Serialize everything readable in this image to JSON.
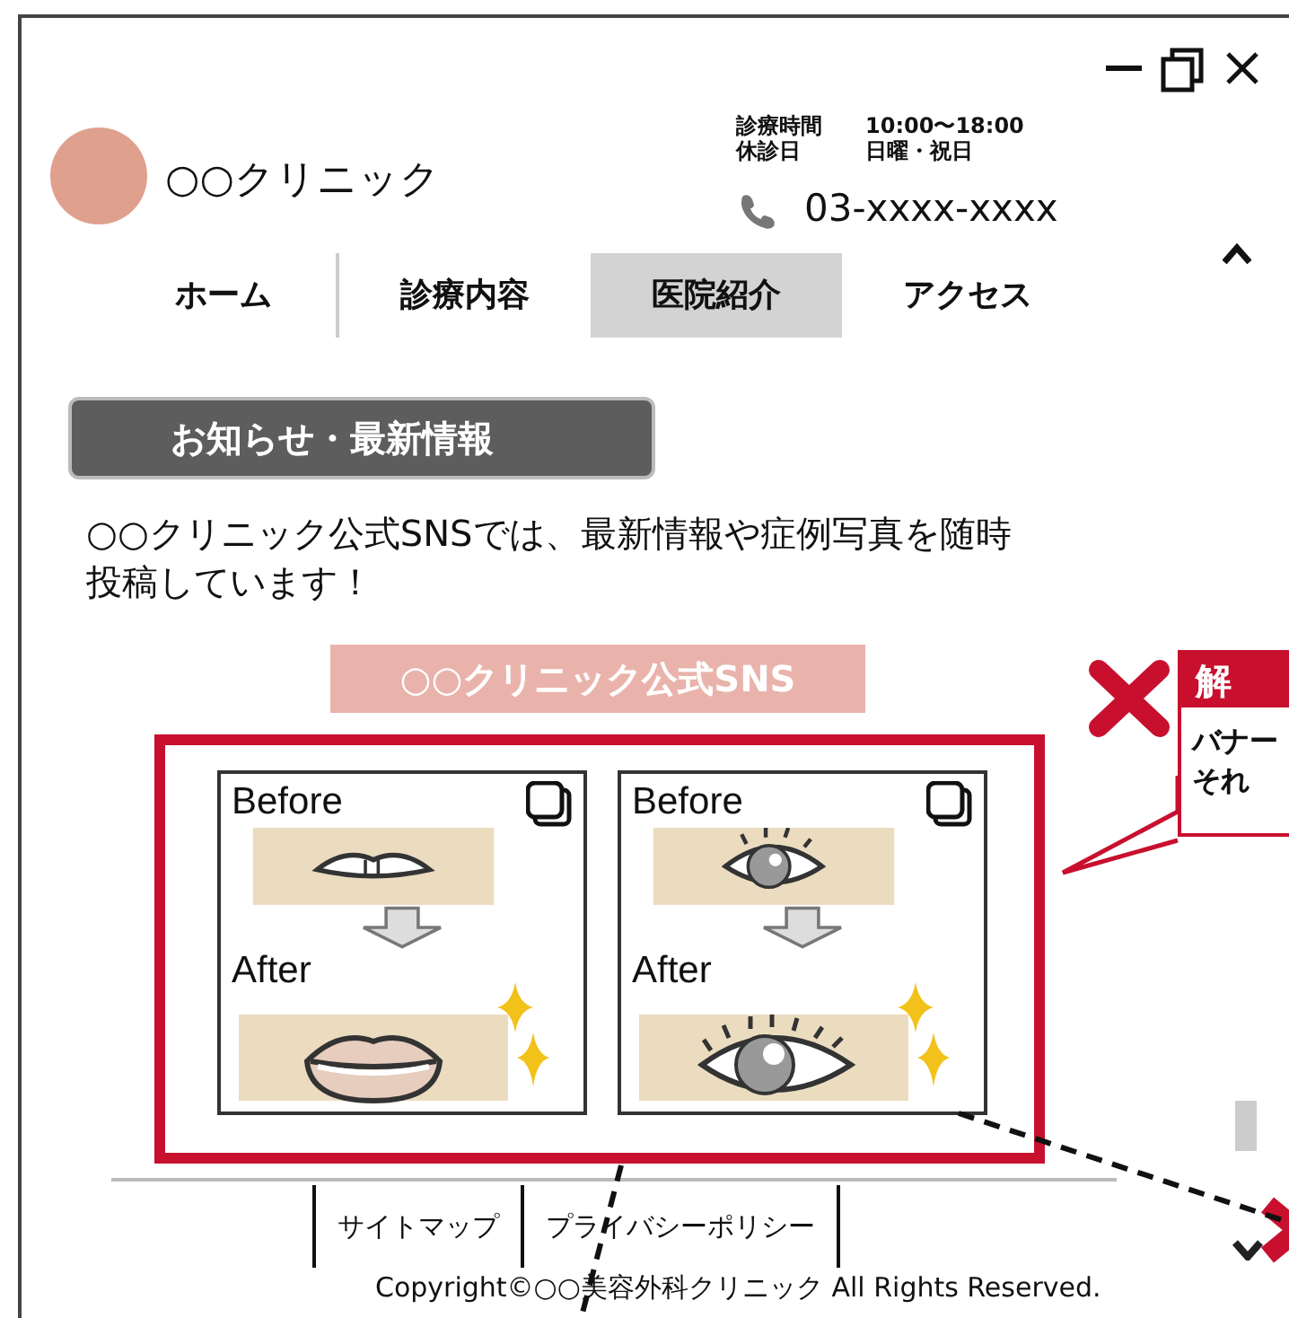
{
  "header": {
    "clinic_name": "○○クリニック",
    "hours": [
      {
        "label": "診療時間",
        "value": "10:00〜18:00"
      },
      {
        "label": "休診日",
        "value": "日曜・祝日"
      }
    ],
    "phone": "03-xxxx-xxxx"
  },
  "nav": [
    {
      "label": "ホーム",
      "selected": false
    },
    {
      "label": "診療内容",
      "selected": false
    },
    {
      "label": "医院紹介",
      "selected": true
    },
    {
      "label": "アクセス",
      "selected": false
    }
  ],
  "news": {
    "heading": "お知らせ・最新情報",
    "text": "○○クリニック公式SNSでは、最新情報や症例写真を随時投稿しています！",
    "sns_label": "○○クリニック公式SNS",
    "banners": [
      {
        "kind": "lips",
        "before": "Before",
        "after": "After"
      },
      {
        "kind": "eye",
        "before": "Before",
        "after": "After"
      }
    ]
  },
  "callout": {
    "title": "解",
    "lines": [
      "バナー",
      "それ"
    ]
  },
  "footer": {
    "links": [
      "サイトマップ",
      "プライバシーポリシー"
    ],
    "copyright": "Copyright©○○美容外科クリニック All Rights Reserved."
  }
}
